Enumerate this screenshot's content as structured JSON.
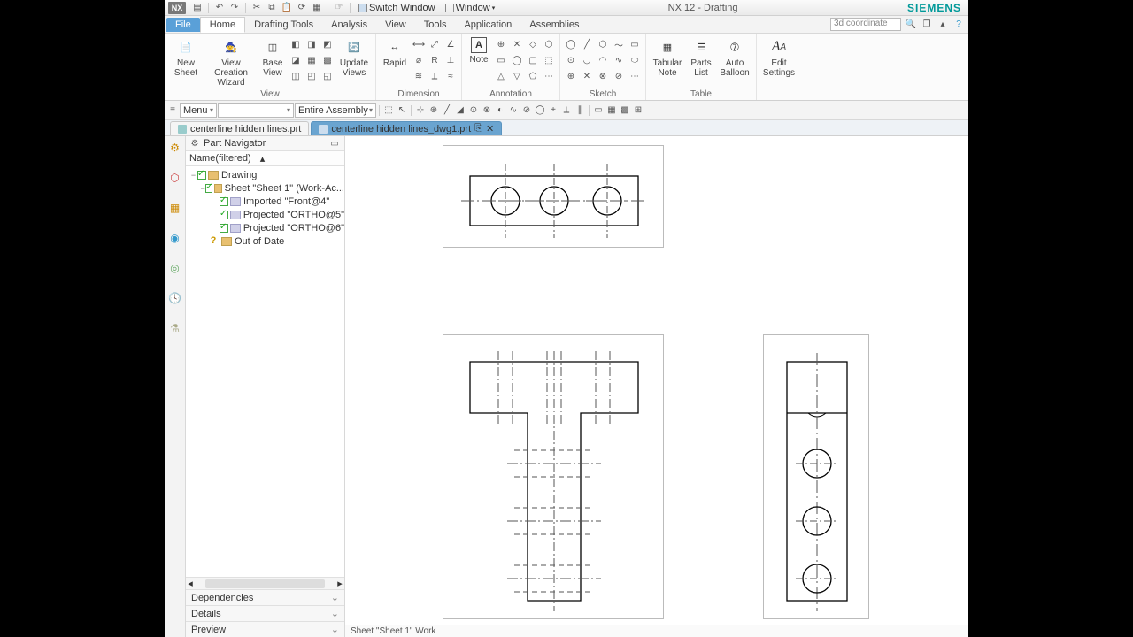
{
  "app_title": "NX 12 - Drafting",
  "brand": "SIEMENS",
  "nx_logo": "NX",
  "qat": {
    "switch_window": "Switch Window",
    "window": "Window"
  },
  "search_placeholder": "3d coordinate",
  "menu_tabs": {
    "file": "File",
    "home": "Home",
    "drafting": "Drafting Tools",
    "analysis": "Analysis",
    "view": "View",
    "tools": "Tools",
    "application": "Application",
    "assemblies": "Assemblies"
  },
  "ribbon": {
    "view_group": "View",
    "new_sheet": "New\nSheet",
    "view_creation": "View Creation\nWizard",
    "base_view": "Base\nView",
    "update_views": "Update\nViews",
    "dimension_group": "Dimension",
    "rapid": "Rapid",
    "annotation_group": "Annotation",
    "note": "Note",
    "sketch_group": "Sketch",
    "table_group": "Table",
    "tabular_note": "Tabular\nNote",
    "parts_list": "Parts\nList",
    "auto_balloon": "Auto\nBalloon",
    "edit_settings": "Edit\nSettings"
  },
  "toolbar2": {
    "menu": "Menu",
    "assembly_filter": "Entire Assembly"
  },
  "doc_tabs": {
    "tab1": "centerline hidden lines.prt",
    "tab2": "centerline hidden lines_dwg1.prt"
  },
  "navigator": {
    "title": "Part Navigator",
    "filter_label": "Name(filtered)",
    "drawing": "Drawing",
    "sheet": "Sheet \"Sheet 1\" (Work-Ac...",
    "front": "Imported \"Front@4\"",
    "ortho5": "Projected \"ORTHO@5\"",
    "ortho6": "Projected \"ORTHO@6\"",
    "out_of_date": "Out of Date",
    "dependencies": "Dependencies",
    "details": "Details",
    "preview": "Preview"
  },
  "status_text": "Sheet \"Sheet 1\" Work"
}
